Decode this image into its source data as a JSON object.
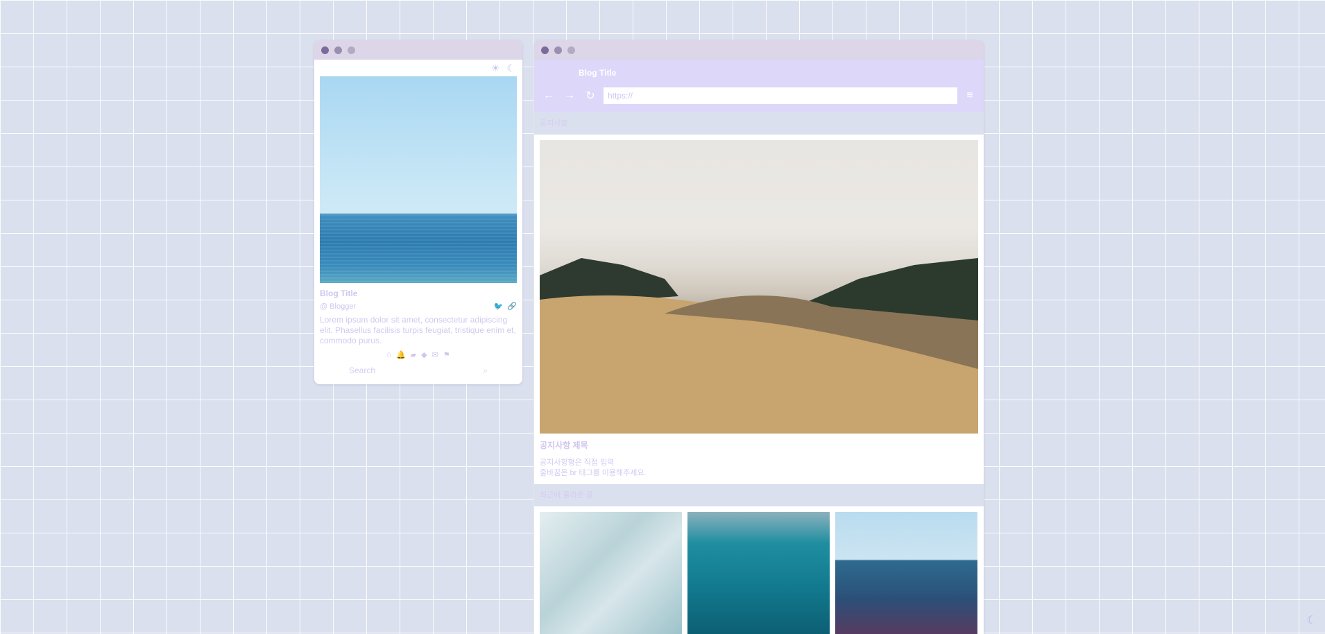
{
  "profile": {
    "theme_light_icon": "sun-icon",
    "theme_dark_icon": "moon-icon",
    "title": "Blog Title",
    "author": "@ Blogger",
    "description": "Lorem ipsum dolor sit amet, consectetur adipiscing elit. Phasellus facilisis turpis feugiat, tristique enim et, commodo purus.",
    "socials": [
      "twitter-icon",
      "link-icon"
    ],
    "nav_icons": [
      "home-icon",
      "bell-icon",
      "folder-icon",
      "tag-icon",
      "mail-icon",
      "flag-icon"
    ],
    "search_placeholder": "Search"
  },
  "browser": {
    "brand": "Blog Title",
    "url_placeholder": "https://",
    "notice_section_label": "공지사항",
    "notice_title": "공지사항 제목",
    "notice_body_line1": "공지사항형은 직접 입력",
    "notice_body_line2": "줄바꿈은 br 태그를 이용해주세요.",
    "recent_section_label": "최근에 올라온 글"
  },
  "colors": {
    "accent": "#ddd7fa",
    "text_muted": "#cfc6ef",
    "background": "#dbe0ee"
  }
}
